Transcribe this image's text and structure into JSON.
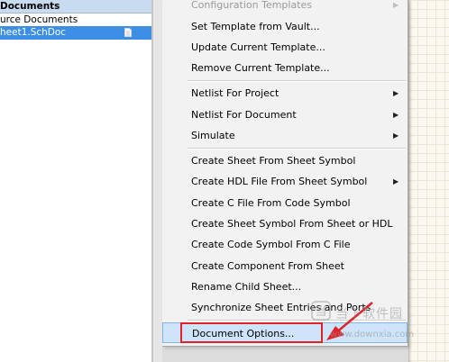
{
  "project_panel": {
    "header": "Documents",
    "source_row": "urce Documents",
    "sheet_row": "heet1.SchDoc"
  },
  "menu": {
    "items": [
      {
        "label": "Configuration Templates",
        "submenu": true,
        "disabled": true
      },
      {
        "label": "Set Template from Vault...",
        "submenu": false
      },
      {
        "label": "Update Current Template...",
        "submenu": false
      },
      {
        "label": "Remove Current Template...",
        "submenu": false
      },
      {
        "label": "Netlist For Project",
        "submenu": true
      },
      {
        "label": "Netlist For Document",
        "submenu": true
      },
      {
        "label": "Simulate",
        "submenu": true
      },
      {
        "label": "Create Sheet From Sheet Symbol",
        "submenu": false
      },
      {
        "label": "Create HDL File From Sheet Symbol",
        "submenu": true
      },
      {
        "label": "Create C File From Code Symbol",
        "submenu": false
      },
      {
        "label": "Create Sheet Symbol From Sheet or HDL",
        "submenu": false
      },
      {
        "label": "Create Code Symbol From C File",
        "submenu": false
      },
      {
        "label": "Create Component From Sheet",
        "submenu": false
      },
      {
        "label": "Rename Child Sheet...",
        "submenu": false
      },
      {
        "label": "Synchronize Sheet Entries and Ports",
        "submenu": false
      },
      {
        "label": "Document Options...",
        "submenu": false,
        "highlighted": true
      }
    ],
    "submenu_arrow": "▶"
  },
  "watermark": {
    "logo_text": "当",
    "cn_text": "当下软件园",
    "url": "www.downxia.com"
  },
  "colors": {
    "menu_bg": "#f2f2f2",
    "highlight": "#cde4fa",
    "selection": "#3d8fe6",
    "annotation": "#e0222a"
  }
}
